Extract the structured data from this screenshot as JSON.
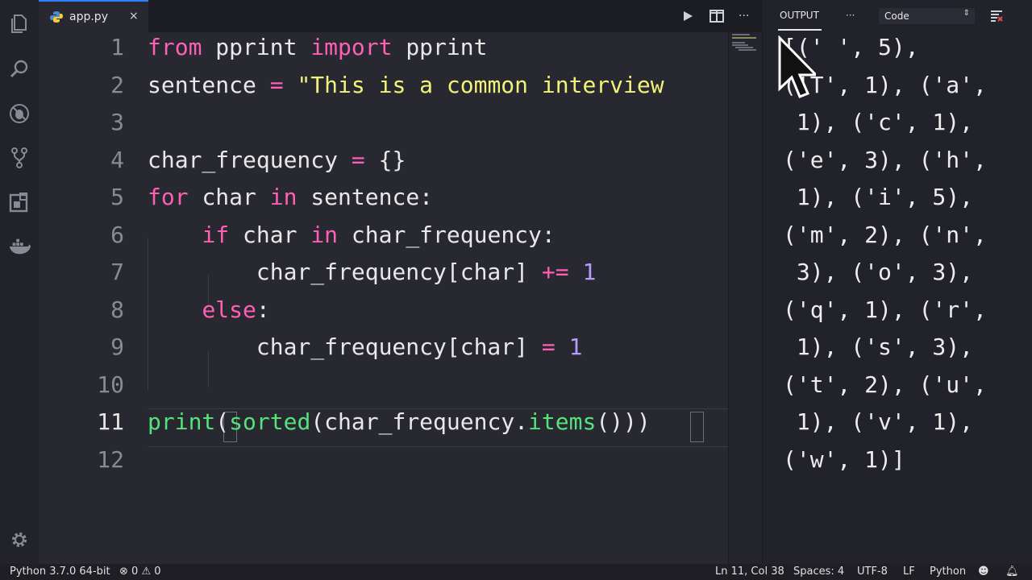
{
  "tab": {
    "filename": "app.py",
    "close_glyph": "×"
  },
  "editor": {
    "lines": [
      {
        "num": "1",
        "tokens": [
          [
            "kw",
            "from"
          ],
          [
            "",
            ""
          ],
          [
            "",
            "pprint"
          ],
          [
            "",
            ""
          ],
          [
            "kw",
            "import"
          ],
          [
            "",
            ""
          ],
          [
            "",
            "pprint"
          ]
        ]
      },
      {
        "num": "2",
        "tokens": [
          [
            "",
            "sentence"
          ],
          [
            "",
            ""
          ],
          [
            "op",
            "="
          ],
          [
            "",
            ""
          ],
          [
            "str",
            "\"This is a common interview"
          ]
        ]
      },
      {
        "num": "3",
        "tokens": []
      },
      {
        "num": "4",
        "tokens": [
          [
            "",
            "char_frequency"
          ],
          [
            "",
            ""
          ],
          [
            "op",
            "="
          ],
          [
            "",
            ""
          ],
          [
            "",
            "{}"
          ]
        ]
      },
      {
        "num": "5",
        "tokens": [
          [
            "kw",
            "for"
          ],
          [
            "",
            ""
          ],
          [
            "",
            "char"
          ],
          [
            "",
            ""
          ],
          [
            "kw",
            "in"
          ],
          [
            "",
            ""
          ],
          [
            "",
            "sentence:"
          ]
        ]
      },
      {
        "num": "6",
        "tokens": [
          [
            "",
            "    "
          ],
          [
            "kw",
            "if"
          ],
          [
            "",
            ""
          ],
          [
            "",
            "char"
          ],
          [
            "",
            ""
          ],
          [
            "kw",
            "in"
          ],
          [
            "",
            ""
          ],
          [
            "",
            "char_frequency:"
          ]
        ]
      },
      {
        "num": "7",
        "tokens": [
          [
            "",
            "        "
          ],
          [
            "",
            "char_frequency[char]"
          ],
          [
            "",
            ""
          ],
          [
            "op",
            "+="
          ],
          [
            "",
            ""
          ],
          [
            "num",
            "1"
          ]
        ]
      },
      {
        "num": "8",
        "tokens": [
          [
            "",
            "    "
          ],
          [
            "kw",
            "else"
          ],
          [
            "",
            ":"
          ]
        ]
      },
      {
        "num": "9",
        "tokens": [
          [
            "",
            "        "
          ],
          [
            "",
            "char_frequency[char]"
          ],
          [
            "",
            ""
          ],
          [
            "op",
            "="
          ],
          [
            "",
            ""
          ],
          [
            "num",
            "1"
          ]
        ]
      },
      {
        "num": "10",
        "tokens": []
      },
      {
        "num": "11",
        "tokens": [
          [
            "fn",
            "print"
          ],
          [
            "",
            "("
          ],
          [
            "fn",
            "sorted"
          ],
          [
            "",
            "(char_frequency."
          ],
          [
            "fn",
            "items"
          ],
          [
            "",
            "())"
          ],
          [
            "",
            ")"
          ]
        ]
      },
      {
        "num": "12",
        "tokens": []
      }
    ]
  },
  "panel": {
    "title": "OUTPUT",
    "more_glyph": "···",
    "channel": "Code",
    "output_lines": [
      "[(' ', 5),",
      "('T', 1), ('a',",
      " 1), ('c', 1),",
      "('e', 3), ('h',",
      " 1), ('i', 5),",
      "('m', 2), ('n',",
      " 3), ('o', 3),",
      "('q', 1), ('r',",
      " 1), ('s', 3),",
      "('t', 2), ('u',",
      " 1), ('v', 1),",
      "('w', 1)]"
    ]
  },
  "toolbar": {
    "more_glyph": "···"
  },
  "status": {
    "interpreter": "Python 3.7.0 64-bit",
    "errors": "0",
    "warnings": "0",
    "position": "Ln 11, Col 38",
    "spaces": "Spaces: 4",
    "encoding": "UTF-8",
    "eol": "LF",
    "language": "Python"
  },
  "colors": {
    "keyword": "#ff5fb4",
    "string": "#f2f27a",
    "number": "#b69cff",
    "function": "#54e27b",
    "accent": "#2f80ff"
  },
  "icons": [
    "files-icon",
    "search-icon",
    "debug-icon",
    "source-control-icon",
    "extensions-icon",
    "docker-icon",
    "settings-gear-icon",
    "run-icon",
    "split-editor-icon",
    "more-icon",
    "clear-output-icon",
    "mouse-cursor-icon",
    "text-cursor-icon",
    "python-file-icon",
    "error-icon",
    "warning-icon",
    "smiley-icon",
    "bell-icon"
  ]
}
